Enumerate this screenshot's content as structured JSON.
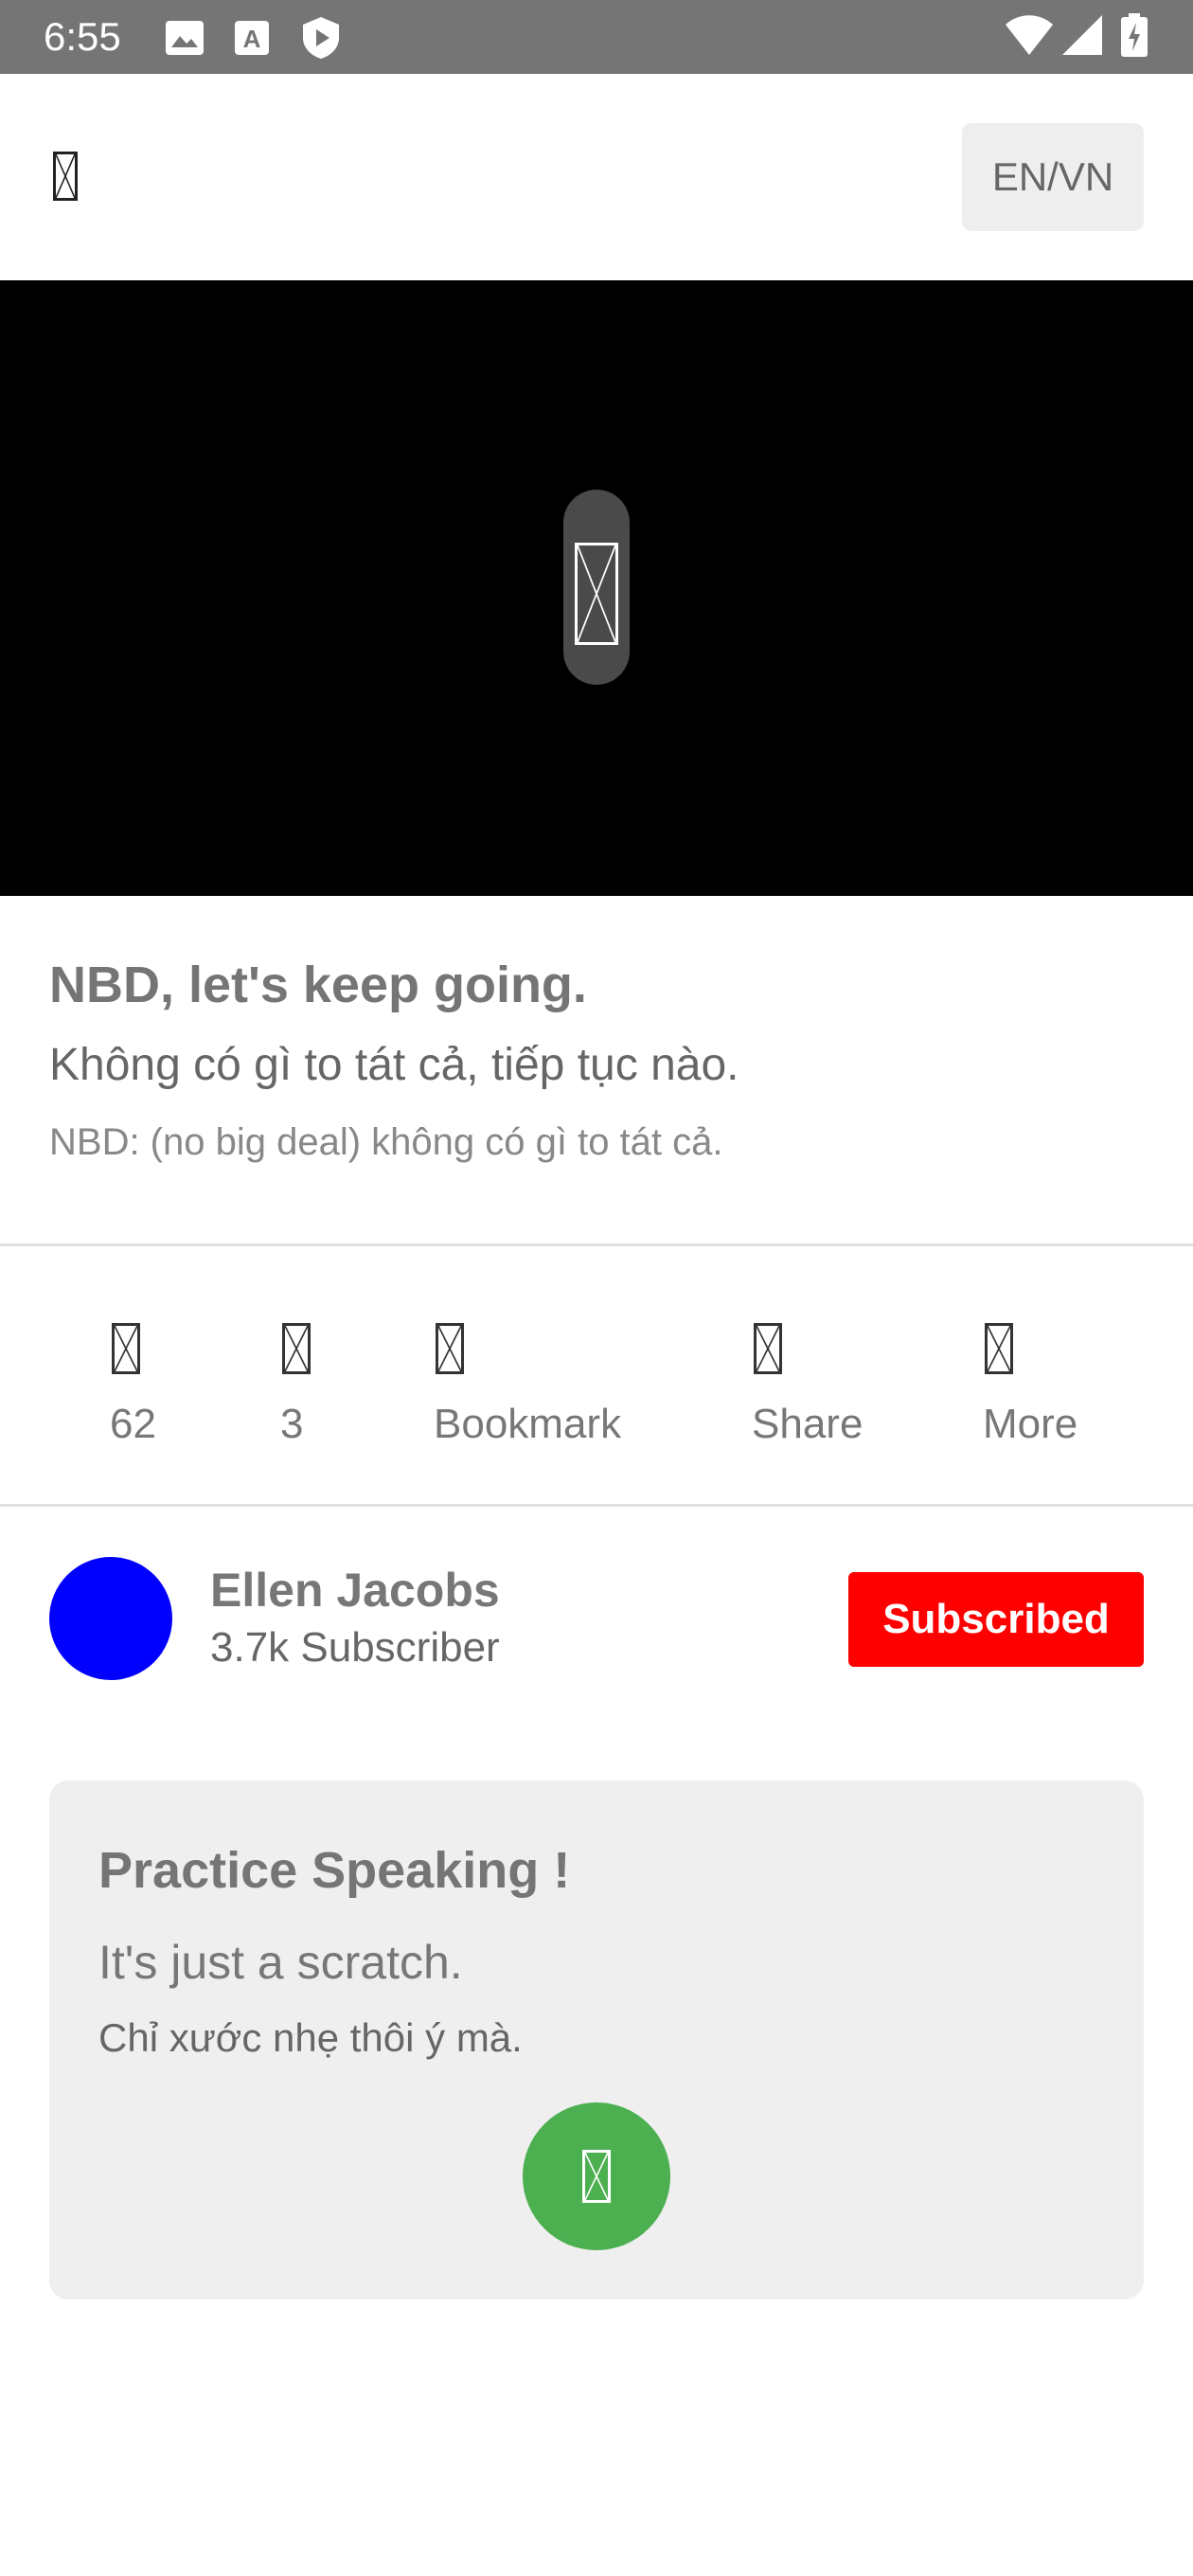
{
  "status_bar": {
    "time": "6:55",
    "left_icons": [
      "image-icon",
      "font-icon",
      "shield-play-icon"
    ],
    "right_icons": [
      "wifi-icon",
      "signal-icon",
      "battery-charging-icon"
    ]
  },
  "header": {
    "menu_icon": "menu-icon",
    "language_toggle_label": "EN/VN"
  },
  "video": {
    "play_icon": "play-icon"
  },
  "caption": {
    "english": "NBD, let's keep going.",
    "vietnamese": "Không có gì to tát cả, tiếp tục nào.",
    "note": "NBD: (no big deal) không có gì to tát cả."
  },
  "actions": [
    {
      "icon": "like-icon",
      "label": "62"
    },
    {
      "icon": "comment-icon",
      "label": "3"
    },
    {
      "icon": "bookmark-icon",
      "label": "Bookmark"
    },
    {
      "icon": "share-icon",
      "label": "Share"
    },
    {
      "icon": "more-icon",
      "label": "More"
    }
  ],
  "channel": {
    "name": "Ellen Jacobs",
    "subscribers": "3.7k Subscriber",
    "subscribe_label": "Subscribed",
    "avatar_color": "#0000ff",
    "subscribe_color": "#ff0000"
  },
  "practice": {
    "title": "Practice Speaking !",
    "english": "It's just a scratch.",
    "vietnamese": "Chỉ xước nhẹ thôi ý mà.",
    "mic_icon": "microphone-icon",
    "mic_color": "#4caf50"
  }
}
